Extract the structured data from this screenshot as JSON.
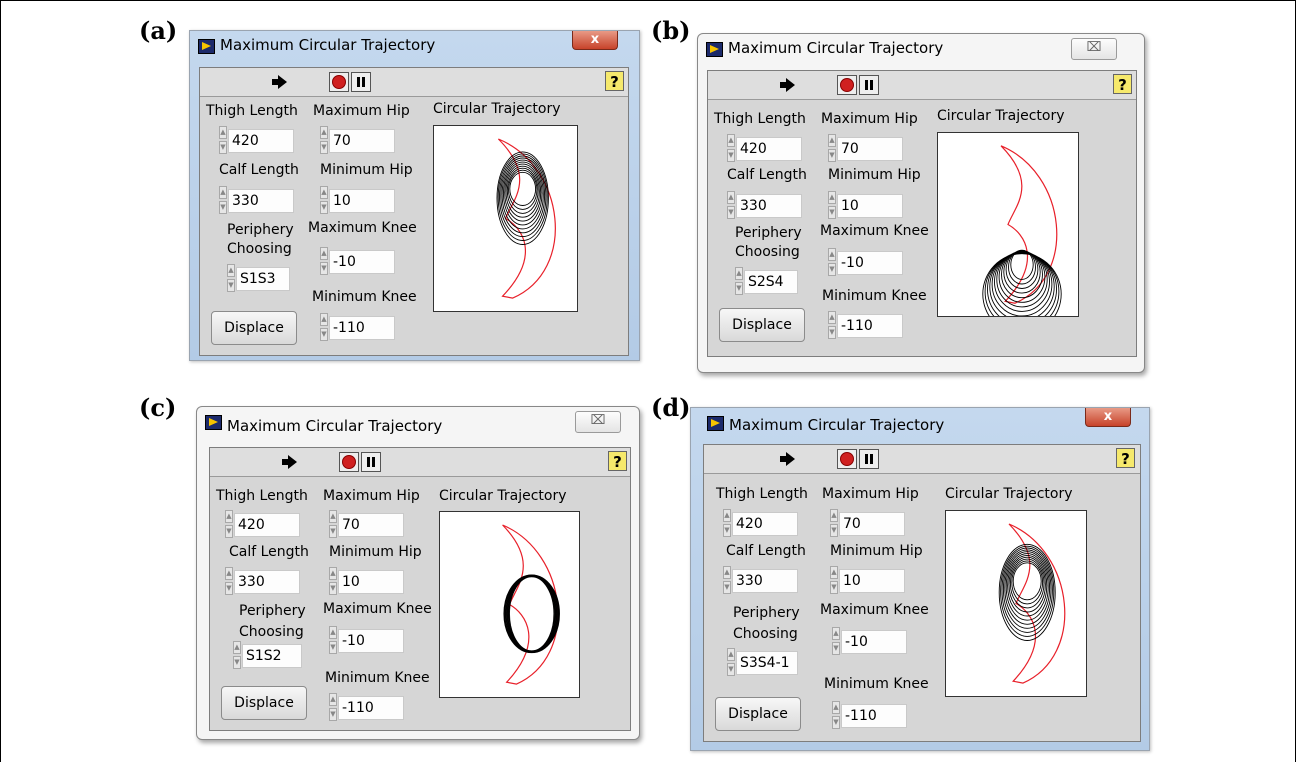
{
  "panel_labels": [
    "(a)",
    "(b)",
    "(c)",
    "(d)"
  ],
  "window": {
    "title": "Maximum Circular Trajectory",
    "close_glyph_red": "x",
    "close_glyph_plain": "⌧"
  },
  "labels": {
    "thigh": "Thigh Length",
    "calf": "Calf Length",
    "periphery_1": "Periphery",
    "periphery_2": "Choosing",
    "max_hip": "Maximum Hip",
    "min_hip": "Minimum Hip",
    "max_knee": "Maximum Knee",
    "min_knee": "Minimum Knee",
    "plot": "Circular Trajectory",
    "displace": "Displace",
    "help": "?"
  },
  "values": {
    "thigh": "420",
    "calf": "330",
    "max_hip": "70",
    "min_hip": "10",
    "max_knee": "-10",
    "min_knee": "-110"
  },
  "windows": [
    {
      "periphery": "S1S3",
      "style": "blue"
    },
    {
      "periphery": "S2S4",
      "style": "white"
    },
    {
      "periphery": "S1S2",
      "style": "white"
    },
    {
      "periphery": "S3S4-1",
      "style": "blue"
    }
  ],
  "colors": {
    "boundary": "#e8202a",
    "trajectory": "#000000"
  },
  "icons": [
    "run-arrow-icon",
    "abort-icon",
    "pause-icon",
    "help-icon",
    "app-icon",
    "close-icon",
    "spin-up-icon",
    "spin-down-icon"
  ]
}
